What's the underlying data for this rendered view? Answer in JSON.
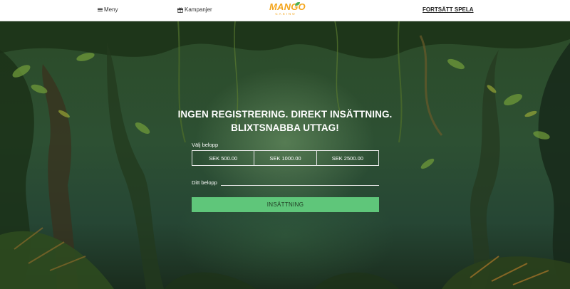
{
  "header": {
    "menu_label": "Meny",
    "promotions_label": "Kampanjer",
    "logo_word": "MANGO",
    "logo_sub": "CASINO",
    "continue_label": "FORTSÄTT SPELA"
  },
  "hero": {
    "headline_line1": "INGEN REGISTRERING. DIREKT INSÄTTNING.",
    "headline_line2": "BLIXTSNABBA UTTAG!",
    "choose_amount_label": "Välj belopp",
    "amount_options": [
      "SEK 500.00",
      "SEK 1000.00",
      "SEK 2500.00"
    ],
    "your_amount_label": "Ditt belopp",
    "your_amount_value": "",
    "deposit_label": "INSÄTTNING"
  },
  "colors": {
    "brand_orange": "#f4a51c",
    "deposit_green": "#5fc67a",
    "jungle_dark": "#1f3a20"
  },
  "icons": [
    "hamburger-icon",
    "gift-icon"
  ]
}
